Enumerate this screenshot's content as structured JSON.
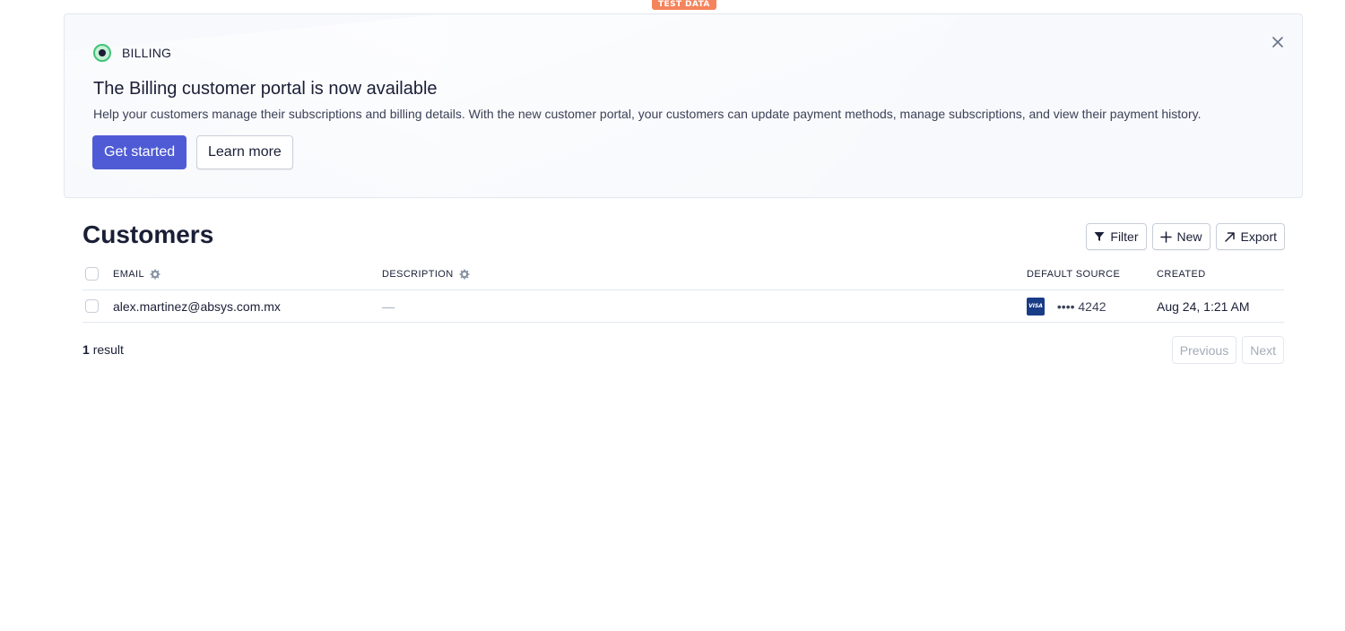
{
  "env_badge": "TEST DATA",
  "banner": {
    "eyebrow": "BILLING",
    "title": "The Billing customer portal is now available",
    "description": "Help your customers manage their subscriptions and billing details. With the new customer portal, your customers can update payment methods, manage subscriptions, and view their payment history.",
    "primary_button": "Get started",
    "secondary_button": "Learn more",
    "close_icon": "close-icon"
  },
  "page": {
    "title": "Customers"
  },
  "toolbar": {
    "filter_label": "Filter",
    "new_label": "New",
    "export_label": "Export"
  },
  "table": {
    "columns": {
      "email": "EMAIL",
      "description": "DESCRIPTION",
      "default_source": "DEFAULT SOURCE",
      "created": "CREATED"
    },
    "rows": [
      {
        "email": "alex.martinez@absys.com.mx",
        "description": "—",
        "card_brand": "VISA",
        "card_last4": "•••• 4242",
        "created": "Aug 24, 1:21 AM"
      }
    ]
  },
  "footer": {
    "result_count": "1",
    "result_label": "result",
    "previous_label": "Previous",
    "next_label": "Next"
  },
  "colors": {
    "accent": "#4f5bd5",
    "badge": "#f5845c",
    "status_green": "#3fc37a",
    "visa": "#1a3c86"
  }
}
